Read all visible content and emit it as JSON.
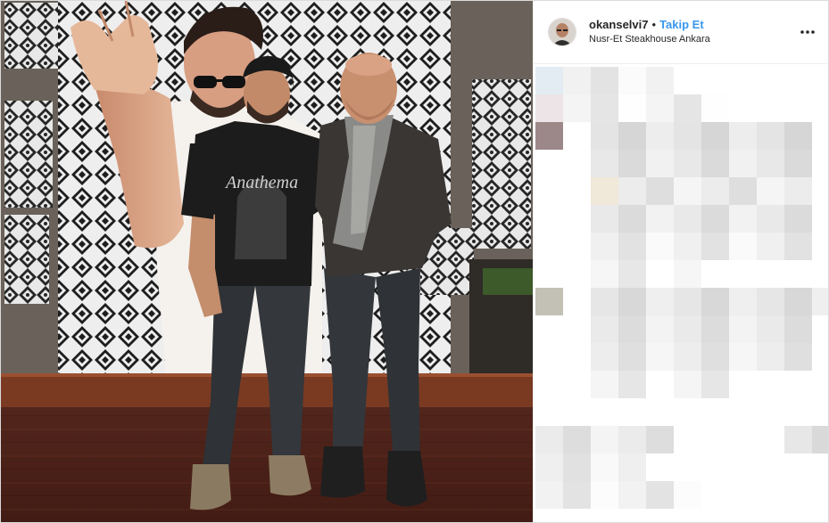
{
  "post": {
    "username": "okanselvi7",
    "separator": "•",
    "follow_label": "Takip Et",
    "location": "Nusr-Et Steakhouse Ankara"
  },
  "icons": {
    "more": "more-horizontal-icon",
    "avatar": "profile-avatar"
  },
  "colors": {
    "follow": "#3897f0",
    "text": "#262626",
    "border": "#dbdbdb"
  },
  "photo": {
    "shirt_text": "Anathema"
  }
}
